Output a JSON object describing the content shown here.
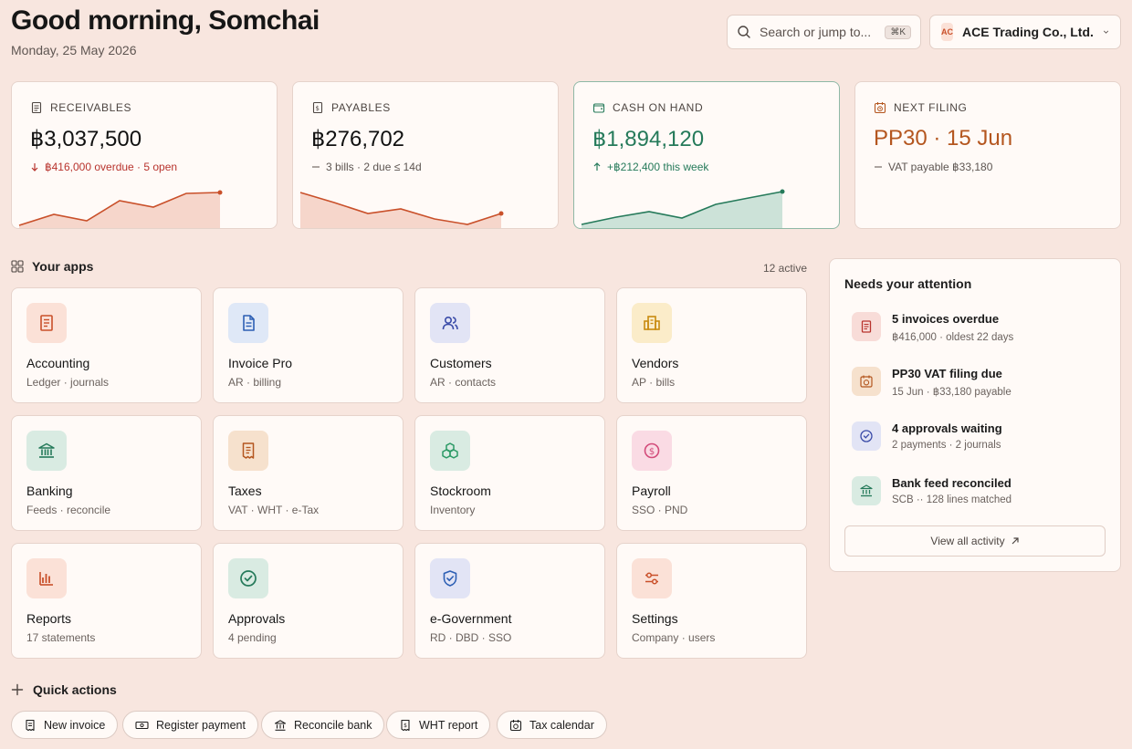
{
  "header": {
    "greeting": "Good morning, Somchai",
    "date": "Monday, 25 May 2026",
    "search_placeholder": "Search or jump to...",
    "search_shortcut": "⌘K",
    "company_badge": "AC",
    "company_name": "ACE Trading Co., Ltd."
  },
  "kpis": {
    "receivables": {
      "label": "RECEIVABLES",
      "value": "฿3,037,500",
      "sub": "฿416,000 overdue · 5 open",
      "color": "#c9502a"
    },
    "payables": {
      "label": "PAYABLES",
      "value": "฿276,702",
      "sub": "3 bills · 2 due ≤ 14d",
      "color": "#c9502a"
    },
    "cash": {
      "label": "CASH ON HAND",
      "value": "฿1,894,120",
      "sub": "+฿212,400 this week",
      "color": "#257a5a"
    },
    "filing": {
      "label": "NEXT FILING",
      "value": "PP30 · 15 Jun",
      "sub": "VAT payable ฿33,180",
      "color": "#b4561f"
    }
  },
  "apps": {
    "heading": "Your apps",
    "count": "12 active",
    "items": [
      {
        "name": "Accounting",
        "desc": "Ledger · journals",
        "icon": "ledger-icon"
      },
      {
        "name": "Invoice Pro",
        "desc": "AR · billing",
        "icon": "document-icon"
      },
      {
        "name": "Customers",
        "desc": "AR · contacts",
        "icon": "users-icon"
      },
      {
        "name": "Vendors",
        "desc": "AP · bills",
        "icon": "building-icon"
      },
      {
        "name": "Banking",
        "desc": "Feeds · reconcile",
        "icon": "bank-icon"
      },
      {
        "name": "Taxes",
        "desc": "VAT · WHT · e-Tax",
        "icon": "receipt-icon"
      },
      {
        "name": "Stockroom",
        "desc": "Inventory",
        "icon": "boxes-icon"
      },
      {
        "name": "Payroll",
        "desc": "SSO · PND",
        "icon": "dollar-circle-icon"
      },
      {
        "name": "Reports",
        "desc": "17 statements",
        "icon": "bar-chart-icon"
      },
      {
        "name": "Approvals",
        "desc": "4 pending",
        "icon": "check-circle-icon"
      },
      {
        "name": "e-Government",
        "desc": "RD · DBD · SSO",
        "icon": "shield-icon"
      },
      {
        "name": "Settings",
        "desc": "Company · users",
        "icon": "sliders-icon"
      }
    ]
  },
  "attention": {
    "heading": "Needs your attention",
    "items": [
      {
        "title": "5 invoices overdue",
        "sub": "฿416,000 · oldest 22 days",
        "icon": "invoice-icon"
      },
      {
        "title": "PP30 VAT filing due",
        "sub": "15 Jun · ฿33,180 payable",
        "icon": "calendar-clock-icon"
      },
      {
        "title": "4 approvals waiting",
        "sub": "2 payments · 2 journals",
        "icon": "check-circle-icon"
      },
      {
        "title": "Bank feed reconciled",
        "sub": "SCB ·· 128 lines matched",
        "icon": "bank-icon"
      }
    ],
    "view_all": "View all activity"
  },
  "quick_actions": {
    "heading": "Quick actions",
    "items": [
      {
        "label": "New invoice",
        "icon": "receipt-icon"
      },
      {
        "label": "Register payment",
        "icon": "cash-icon"
      },
      {
        "label": "Reconcile bank",
        "icon": "bank-icon"
      },
      {
        "label": "WHT report",
        "icon": "receipt-icon"
      },
      {
        "label": "Tax calendar",
        "icon": "calendar-clock-icon"
      }
    ]
  }
}
